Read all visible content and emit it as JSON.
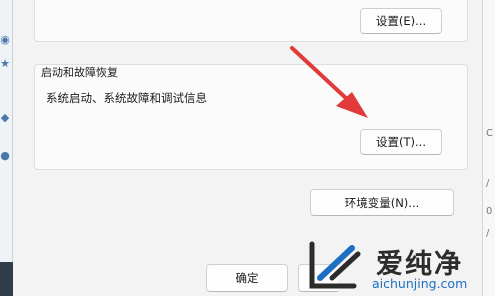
{
  "top_group": {
    "settings_button": "设置(E)..."
  },
  "startup_recovery": {
    "label": "启动和故障恢复",
    "description": "系统启动、系统故障和调试信息",
    "settings_button": "设置(T)..."
  },
  "environment_button": "环境变量(N)...",
  "footer": {
    "ok_button": "确定"
  },
  "watermark": {
    "brand": "爱纯净",
    "url": "aichunjing.com"
  },
  "right_sliver_text": [
    "C",
    "/",
    "0",
    "/"
  ],
  "colors": {
    "arrow": "#e03a3a",
    "link": "#1e6fc4",
    "dialog_bg": "#f3f3f3"
  }
}
